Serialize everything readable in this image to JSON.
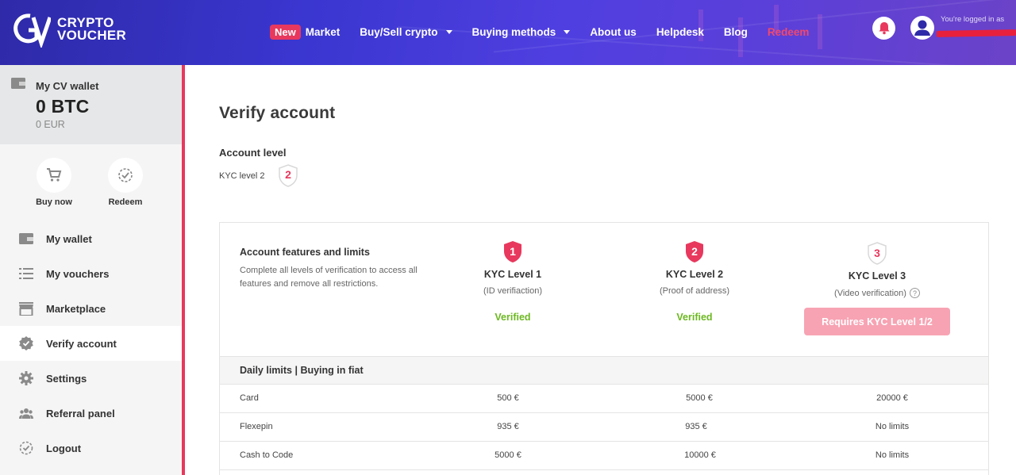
{
  "header": {
    "logo": {
      "line1": "CRYPTO",
      "line2": "VOUCHER"
    },
    "nav": {
      "new_badge": "New",
      "market": "Market",
      "buy_sell": "Buy/Sell crypto",
      "buying_methods": "Buying methods",
      "about": "About us",
      "helpdesk": "Helpdesk",
      "blog": "Blog",
      "redeem": "Redeem"
    },
    "logged_in_label": "You're logged in as",
    "icons": {
      "bell": "bell-icon",
      "user": "user-icon"
    },
    "colors": {
      "accent": "#e8385d"
    }
  },
  "sidebar": {
    "wallet": {
      "title": "My CV wallet",
      "btc": "0 BTC",
      "eur": "0 EUR"
    },
    "quick_actions": [
      {
        "label": "Buy now",
        "icon": "cart-icon"
      },
      {
        "label": "Redeem",
        "icon": "check-circle-icon"
      }
    ],
    "items": [
      {
        "label": "My wallet",
        "icon": "wallet-icon"
      },
      {
        "label": "My vouchers",
        "icon": "list-icon"
      },
      {
        "label": "Marketplace",
        "icon": "store-icon"
      },
      {
        "label": "Verify account",
        "icon": "verified-badge-icon",
        "active": true
      },
      {
        "label": "Settings",
        "icon": "gear-icon"
      },
      {
        "label": "Referral panel",
        "icon": "group-icon"
      },
      {
        "label": "Logout",
        "icon": "logout-icon"
      }
    ]
  },
  "main": {
    "title": "Verify account",
    "account_level": {
      "title": "Account level",
      "value": "KYC level 2",
      "badge": "2"
    },
    "features": {
      "title": "Account features and limits",
      "description": "Complete all levels of verification to access all features and remove all restrictions."
    },
    "kyc_levels": [
      {
        "badge": "1",
        "name": "KYC Level 1",
        "sub": "(ID verifiaction)",
        "status": "Verified"
      },
      {
        "badge": "2",
        "name": "KYC Level 2",
        "sub": "(Proof of address)",
        "status": "Verified"
      },
      {
        "badge": "3",
        "name": "KYC Level 3",
        "sub": "(Video verification)",
        "button": "Requires KYC Level 1/2"
      }
    ],
    "limits": {
      "header": "Daily limits | Buying in fiat",
      "rows": [
        {
          "method": "Card",
          "l1": "500 €",
          "l2": "5000 €",
          "l3": "20000 €"
        },
        {
          "method": "Flexepin",
          "l1": "935 €",
          "l2": "935 €",
          "l3": "No limits"
        },
        {
          "method": "Cash to Code",
          "l1": "5000 €",
          "l2": "10000 €",
          "l3": "No limits"
        }
      ]
    },
    "colors": {
      "verified": "#6cb821",
      "button_disabled": "#f7a3b3"
    }
  }
}
